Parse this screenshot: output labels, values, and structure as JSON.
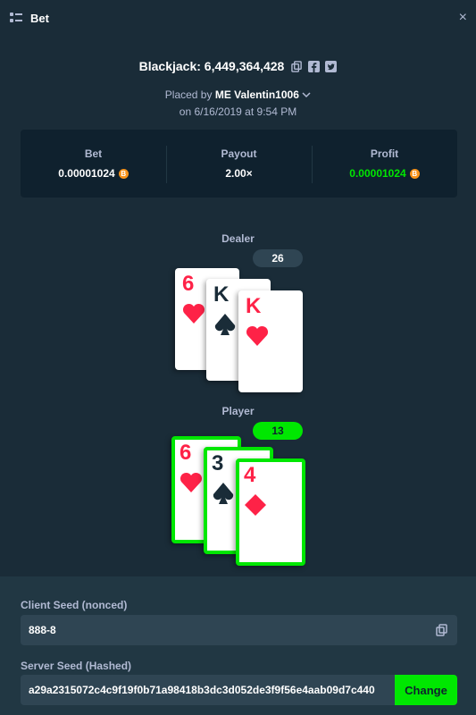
{
  "header": {
    "title": "Bet",
    "close": "×"
  },
  "game": {
    "title": "Blackjack: 6,449,364,428"
  },
  "placed": {
    "prefix": "Placed by",
    "user": "ME Valentin1006",
    "date": "on 6/16/2019 at 9:54 PM"
  },
  "stats": {
    "bet_label": "Bet",
    "bet_value": "0.00001024",
    "payout_label": "Payout",
    "payout_value": "2.00×",
    "profit_label": "Profit",
    "profit_value": "0.00001024",
    "coin_symbol": "B"
  },
  "dealer": {
    "label": "Dealer",
    "score": "26",
    "cards": [
      {
        "rank": "6",
        "suit": "hearts"
      },
      {
        "rank": "K",
        "suit": "spades"
      },
      {
        "rank": "K",
        "suit": "hearts"
      }
    ]
  },
  "player": {
    "label": "Player",
    "score": "13",
    "cards": [
      {
        "rank": "6",
        "suit": "hearts"
      },
      {
        "rank": "3",
        "suit": "spades"
      },
      {
        "rank": "4",
        "suit": "diamonds"
      }
    ]
  },
  "seeds": {
    "client_label": "Client Seed (nonced)",
    "client_value": "888-8",
    "server_label": "Server Seed (Hashed)",
    "server_value": "a29a2315072c4c9f19f0b71a98418b3dc3d052de3f9f56e4aab09d7c440",
    "change_label": "Change"
  },
  "colors": {
    "accent": "#00e701",
    "background": "#1a2c38",
    "panel": "#0f212e",
    "red_suit": "#fe2247"
  }
}
